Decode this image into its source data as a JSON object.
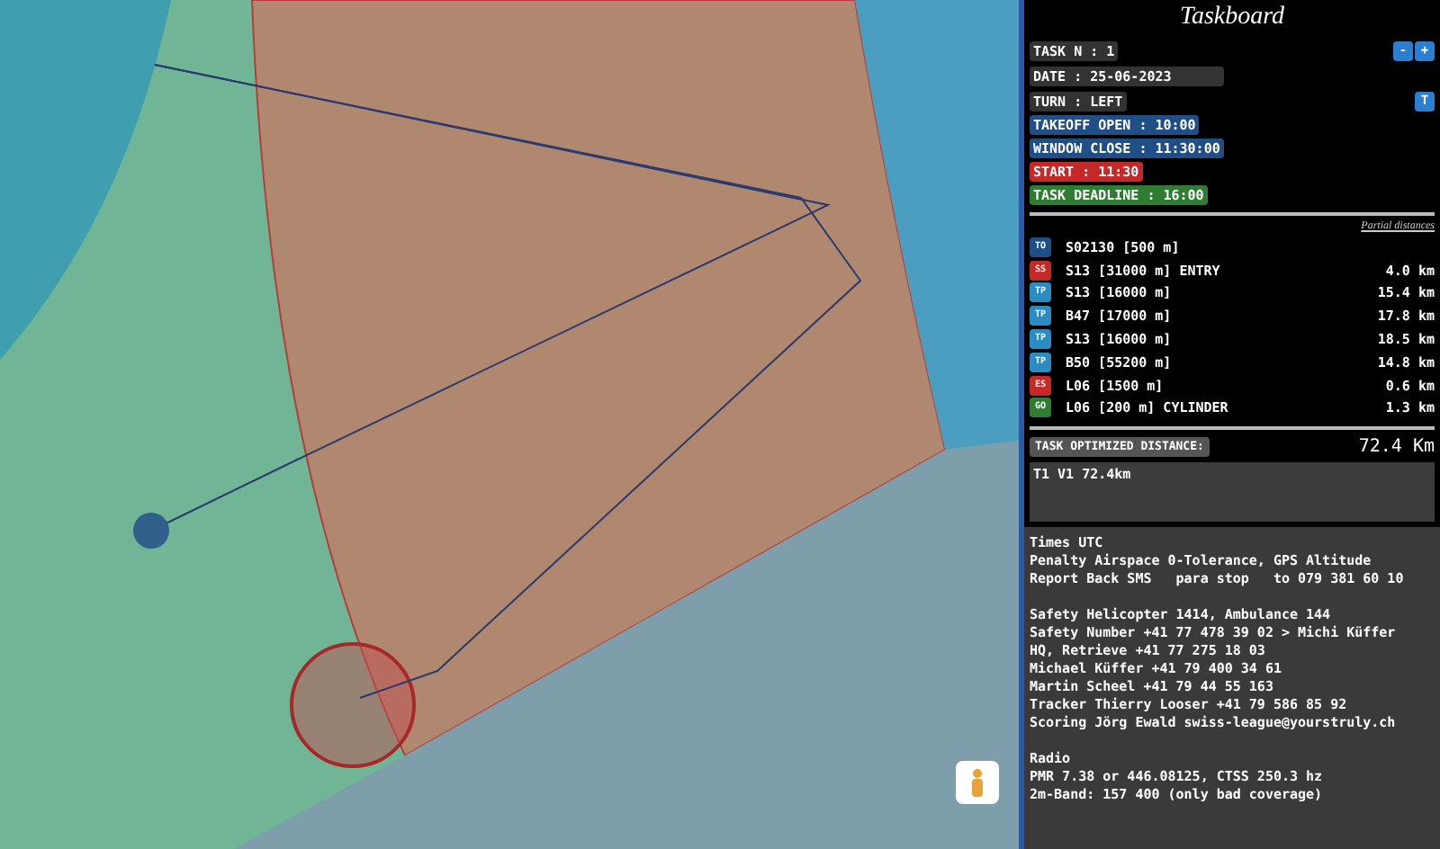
{
  "panel": {
    "title": "Taskboard",
    "task": {
      "label": "TASK N : 1",
      "buttons": [
        "-",
        "+"
      ]
    },
    "date": "DATE : 25-06-2023",
    "turn": {
      "label": "TURN : LEFT",
      "button": "T"
    },
    "times": [
      {
        "text": "TAKEOFF OPEN : 10:00",
        "color": "#1f4f86"
      },
      {
        "text": "WINDOW CLOSE : 11:30:00",
        "color": "#1f4f86"
      },
      {
        "text": "START : 11:30",
        "color": "#c62828"
      },
      {
        "text": "TASK DEADLINE : 16:00",
        "color": "#2e7d32"
      }
    ],
    "partial_heading": "Partial distances",
    "turnpoints": [
      {
        "type": "TO",
        "color": "#1f4f86",
        "name": "S02130 [500 m]"
      },
      {
        "type": "SS",
        "color": "#c62828",
        "name": "S13 [31000 m] ENTRY",
        "distance": "4.0 km"
      },
      {
        "type": "TP",
        "color": "#2b8cc4",
        "name": "S13 [16000 m]",
        "distance": "15.4 km"
      },
      {
        "type": "TP",
        "color": "#2b8cc4",
        "name": "B47 [17000 m]",
        "distance": "17.8 km"
      },
      {
        "type": "TP",
        "color": "#2b8cc4",
        "name": "S13 [16000 m]",
        "distance": "18.5 km"
      },
      {
        "type": "TP",
        "color": "#2b8cc4",
        "name": "B50 [55200 m]",
        "distance": "14.8 km"
      },
      {
        "type": "ES",
        "color": "#c62828",
        "name": "L06 [1500 m]",
        "distance": "0.6 km"
      },
      {
        "type": "GO",
        "color": "#2e7d32",
        "name": "L06 [200 m] CYLINDER",
        "distance": "1.3 km"
      }
    ],
    "total": {
      "label": "TASK OPTIMIZED DISTANCE:",
      "value": "72.4 Km"
    },
    "note": "T1 V1 72.4km",
    "info": [
      [
        "Times UTC",
        "Penalty Airspace 0-Tolerance, GPS Altitude",
        "Report Back SMS   para stop   to 079 381 60 10"
      ],
      [
        "Safety Helicopter 1414, Ambulance 144",
        "Safety Number +41 77 478 39 02 > Michi Küffer",
        "HQ, Retrieve +41 77 275 18 03",
        "Michael Küffer +41 79 400 34 61",
        "Martin Scheel +41 79 44 55 163",
        "Tracker Thierry Looser +41 79 586 85 92",
        "Scoring Jörg Ewald swiss-league@yourstruly.ch"
      ],
      [
        "Radio",
        "PMR 7.38 or 446.08125, CTSS 250.3 hz",
        "2m-Band: 157 400 (only bad coverage)"
      ]
    ]
  }
}
